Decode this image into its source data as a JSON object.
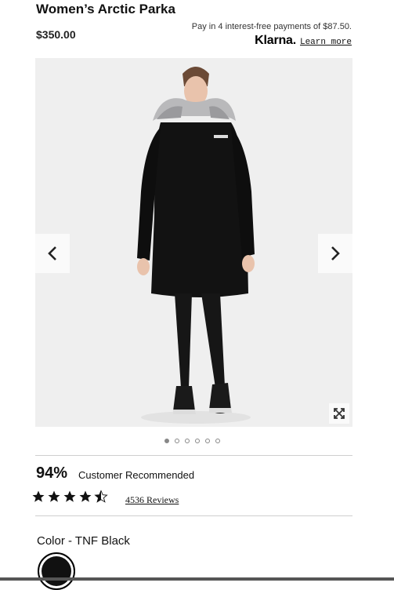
{
  "product": {
    "name": "Women’s Arctic Parka",
    "price": "$350.00"
  },
  "klarna": {
    "message": "Pay in 4 interest-free payments of $87.50.",
    "logo": "Klarna.",
    "learn_more": "Learn more"
  },
  "gallery": {
    "image_count": 6,
    "active_index": 0,
    "prev_icon": "chevron-left-icon",
    "next_icon": "chevron-right-icon",
    "expand_icon": "expand-icon"
  },
  "rating": {
    "percent": "94%",
    "recommended_label": "Customer Recommended",
    "stars": 4.5,
    "reviews_link": "4536 Reviews"
  },
  "color": {
    "label": "Color",
    "separator": " - ",
    "value": "TNF Black",
    "swatch_hex": "#111111"
  }
}
